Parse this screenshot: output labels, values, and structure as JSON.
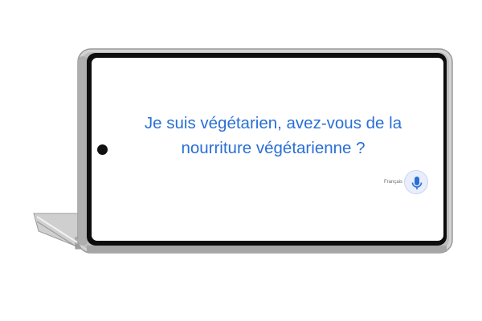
{
  "translation": {
    "line1": "Je suis végétarien, avez-vous de la",
    "line2": "nourriture végétarienne ?"
  },
  "language": {
    "label": "Français"
  },
  "mic": {
    "icon": "microphone-icon",
    "accent": "#2a6fd6"
  },
  "colors": {
    "text_accent": "#2a6fd6",
    "frame": "#c7c7c7",
    "bezel": "#0d0d0d",
    "screen": "#ffffff"
  }
}
